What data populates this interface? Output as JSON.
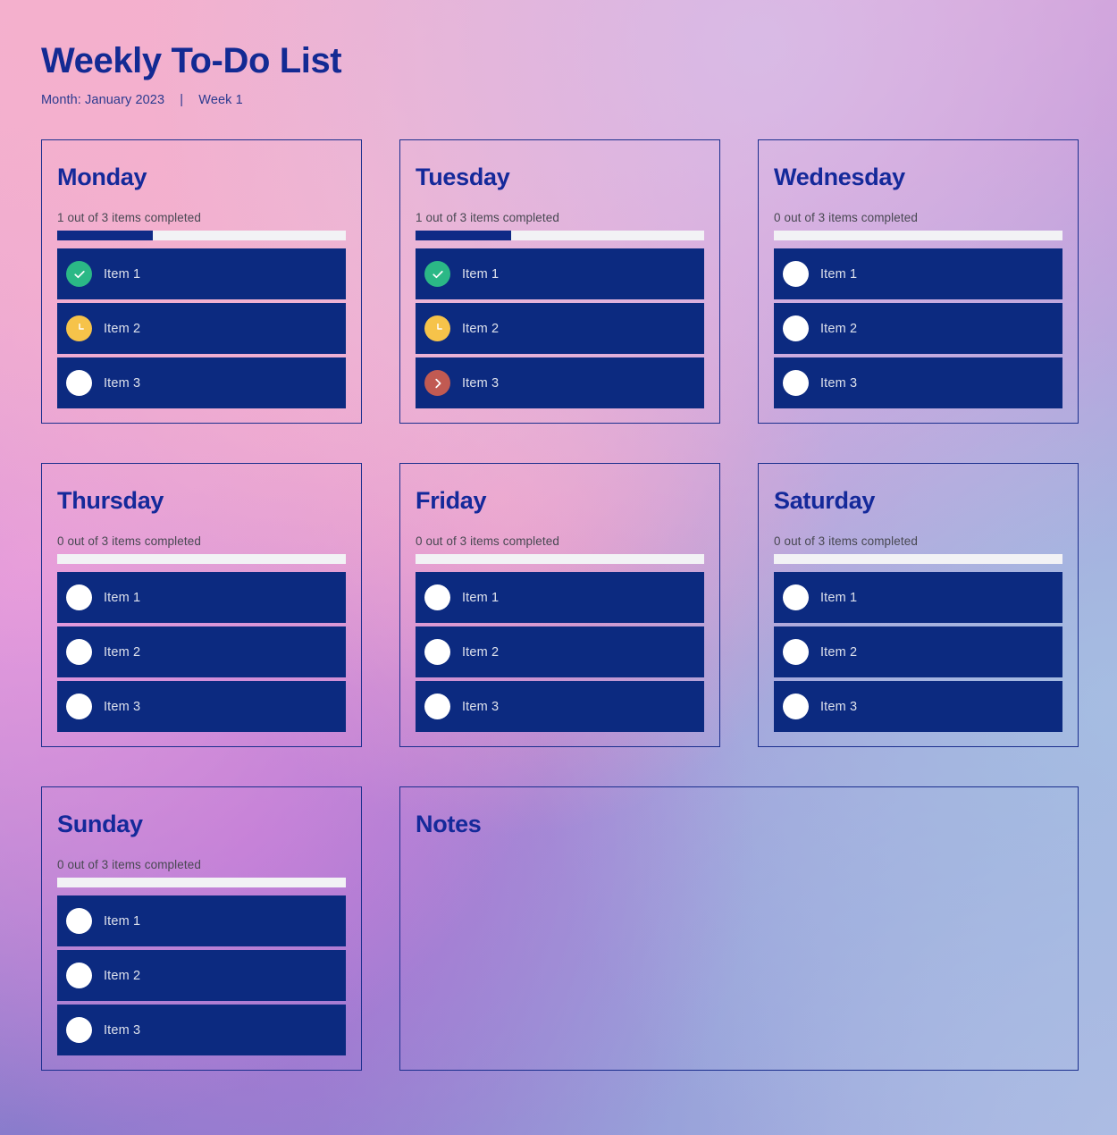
{
  "header": {
    "title": "Weekly To-Do List",
    "month_label": "Month: January 2023",
    "separator": "|",
    "week_label": "Week 1"
  },
  "colors": {
    "heading": "#14299a",
    "card_border": "#1b2f8e",
    "item_row": "#0c2a80",
    "progress_fill": "#0f2a86",
    "progress_track": "#f2f2f5",
    "status_done": "#2bb886",
    "status_progress": "#f6c34a",
    "status_deferred": "#c15a52",
    "status_todo": "#ffffff",
    "bg_top_left": "#f3b2cf",
    "bg_top_right": "#d7bde4",
    "bg_bottom_left": "#7a7fc9",
    "bg_bottom_right": "#aebbe4"
  },
  "days": [
    {
      "name": "Monday",
      "progress_text": "1 out of 3 items completed",
      "completed": 1,
      "total": 3,
      "percent": 33,
      "items": [
        {
          "label": "Item 1",
          "status": "done"
        },
        {
          "label": "Item 2",
          "status": "progress"
        },
        {
          "label": "Item 3",
          "status": "todo"
        }
      ]
    },
    {
      "name": "Tuesday",
      "progress_text": "1 out of 3 items completed",
      "completed": 1,
      "total": 3,
      "percent": 33,
      "items": [
        {
          "label": "Item 1",
          "status": "done"
        },
        {
          "label": "Item 2",
          "status": "progress"
        },
        {
          "label": "Item 3",
          "status": "deferred"
        }
      ]
    },
    {
      "name": "Wednesday",
      "progress_text": "0 out of 3 items completed",
      "completed": 0,
      "total": 3,
      "percent": 0,
      "items": [
        {
          "label": "Item 1",
          "status": "todo"
        },
        {
          "label": "Item 2",
          "status": "todo"
        },
        {
          "label": "Item 3",
          "status": "todo"
        }
      ]
    },
    {
      "name": "Thursday",
      "progress_text": "0 out of 3 items completed",
      "completed": 0,
      "total": 3,
      "percent": 0,
      "items": [
        {
          "label": "Item 1",
          "status": "todo"
        },
        {
          "label": "Item 2",
          "status": "todo"
        },
        {
          "label": "Item 3",
          "status": "todo"
        }
      ]
    },
    {
      "name": "Friday",
      "progress_text": "0 out of 3 items completed",
      "completed": 0,
      "total": 3,
      "percent": 0,
      "items": [
        {
          "label": "Item 1",
          "status": "todo"
        },
        {
          "label": "Item 2",
          "status": "todo"
        },
        {
          "label": "Item 3",
          "status": "todo"
        }
      ]
    },
    {
      "name": "Saturday",
      "progress_text": "0 out of 3 items completed",
      "completed": 0,
      "total": 3,
      "percent": 0,
      "items": [
        {
          "label": "Item 1",
          "status": "todo"
        },
        {
          "label": "Item 2",
          "status": "todo"
        },
        {
          "label": "Item 3",
          "status": "todo"
        }
      ]
    },
    {
      "name": "Sunday",
      "progress_text": "0 out of 3 items completed",
      "completed": 0,
      "total": 3,
      "percent": 0,
      "items": [
        {
          "label": "Item 1",
          "status": "todo"
        },
        {
          "label": "Item 2",
          "status": "todo"
        },
        {
          "label": "Item 3",
          "status": "todo"
        }
      ]
    }
  ],
  "notes": {
    "title": "Notes",
    "content": ""
  },
  "status_icons": {
    "done": "check-circle-icon",
    "progress": "clock-circle-icon",
    "deferred": "chevron-right-circle-icon",
    "todo": "empty-circle-icon"
  }
}
